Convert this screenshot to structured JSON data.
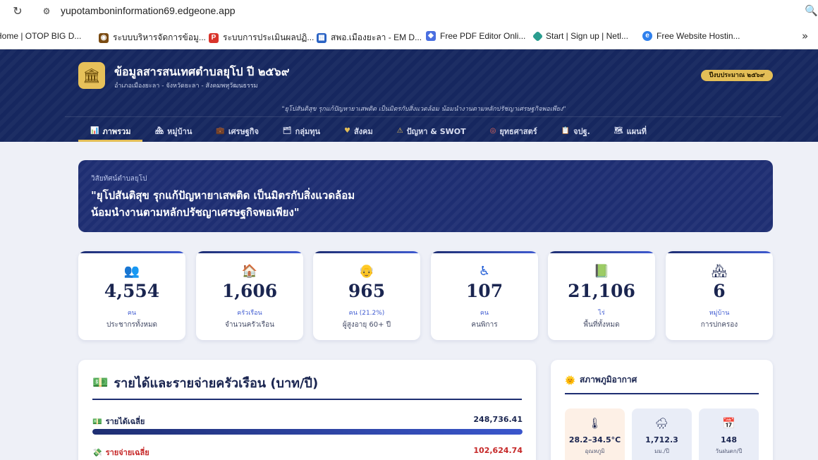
{
  "browser": {
    "url": "yupotamboninformation69.edgeone.app",
    "bookmarks": [
      {
        "label": "Home | OTOP BIG D...",
        "icon": "otop-icon",
        "color": "#d94a2a"
      },
      {
        "label": "ระบบบริหารจัดการข้อมู...",
        "icon": "emblem-icon",
        "color": "#7a4b12"
      },
      {
        "label": "ระบบการประเมินผลปฏิ...",
        "icon": "p-logo-icon",
        "color": "#d9342b"
      },
      {
        "label": "สพอ.เมืองยะลา - EM D...",
        "icon": "em-icon",
        "color": "#2b63c4"
      },
      {
        "label": "Free PDF Editor Onli...",
        "icon": "pdf-editor-icon",
        "color": "#4a6fe0"
      },
      {
        "label": "Start | Sign up | Netl...",
        "icon": "netlify-icon",
        "color": "#2a9d8f"
      },
      {
        "label": "Free Website Hostin...",
        "icon": "hosting-icon",
        "color": "#2f80ed"
      }
    ]
  },
  "site": {
    "title": "ข้อมูลสารสนเทศตำบลยุโป ปี ๒๕๖๙",
    "subtitle": "อำเภอเมืองยะลา - จังหวัดยะลา - สังคมพหุวัฒนธรรม",
    "fiscal_badge": "ปีงบประมาณ ๒๕๖๙",
    "motto": "\"ยุโปสันติสุข รุกแก้ปัญหายาเสพติด เป็นมิตรกับสิ่งแวดล้อม น้อมนำงานตามหลักปรัชญาเศรษฐกิจพอเพียง\""
  },
  "nav": [
    {
      "label": "ภาพรวม",
      "icon": "📊",
      "active": true
    },
    {
      "label": "หมู่บ้าน",
      "icon": "🏘",
      "active": false
    },
    {
      "label": "เศรษฐกิจ",
      "icon": "💼",
      "active": false
    },
    {
      "label": "กลุ่มทุน",
      "icon": "🗂",
      "active": false
    },
    {
      "label": "สังคม",
      "icon": "♥",
      "active": false
    },
    {
      "label": "ปัญหา & SWOT",
      "icon": "⚠",
      "active": false
    },
    {
      "label": "ยุทธศาสตร์",
      "icon": "◎",
      "active": false
    },
    {
      "label": "จปฐ.",
      "icon": "📋",
      "active": false
    },
    {
      "label": "แผนที่",
      "icon": "🗺",
      "active": false
    }
  ],
  "vision": {
    "label": "วิสัยทัศน์ตำบลยุโป",
    "line1": "\"ยุโปสันติสุข รุกแก้ปัญหายาเสพติด เป็นมิตรกับสิ่งแวดล้อม",
    "line2": "น้อมนำงานตามหลักปรัชญาเศรษฐกิจพอเพียง\""
  },
  "stats": [
    {
      "icon": "👥",
      "value": "4,554",
      "unit": "คน",
      "label": "ประชากรทั้งหมด"
    },
    {
      "icon": "🏠",
      "value": "1,606",
      "unit": "ครัวเรือน",
      "label": "จำนวนครัวเรือน"
    },
    {
      "icon": "👴",
      "value": "965",
      "unit": "คน (21.2%)",
      "label": "ผู้สูงอายุ 60+ ปี"
    },
    {
      "icon": "♿",
      "value": "107",
      "unit": "คน",
      "label": "คนพิการ"
    },
    {
      "icon": "📗",
      "value": "21,106",
      "unit": "ไร่",
      "label": "พื้นที่ทั้งหมด"
    },
    {
      "icon": "🏘",
      "value": "6",
      "unit": "หมู่บ้าน",
      "label": "การปกครอง"
    }
  ],
  "income": {
    "title": "รายได้และรายจ่ายครัวเรือน (บาท/ปี)",
    "title_icon": "💵",
    "rows": [
      {
        "icon": "💵",
        "label": "รายได้เฉลี่ย",
        "value": "248,736.41",
        "fill_ratio": 1.0,
        "color": "#1a2550"
      },
      {
        "icon": "💸",
        "label": "รายจ่ายเฉลี่ย",
        "value": "102,624.74",
        "fill_ratio": 0.41,
        "color": "#c62828"
      }
    ]
  },
  "weather": {
    "title": "สภาพภูมิอากาศ",
    "title_icon": "🌞",
    "items": [
      {
        "icon": "🌡",
        "value": "28.2–34.5°C",
        "label": "อุณหภูมิ",
        "bg": "#fdf0e6"
      },
      {
        "icon": "🌧",
        "value": "1,712.3",
        "label": "มม./ปี",
        "bg": "#e9edf7"
      },
      {
        "icon": "📅",
        "value": "148",
        "label": "วันฝนตก/ปี",
        "bg": "#e9edf7"
      }
    ]
  }
}
